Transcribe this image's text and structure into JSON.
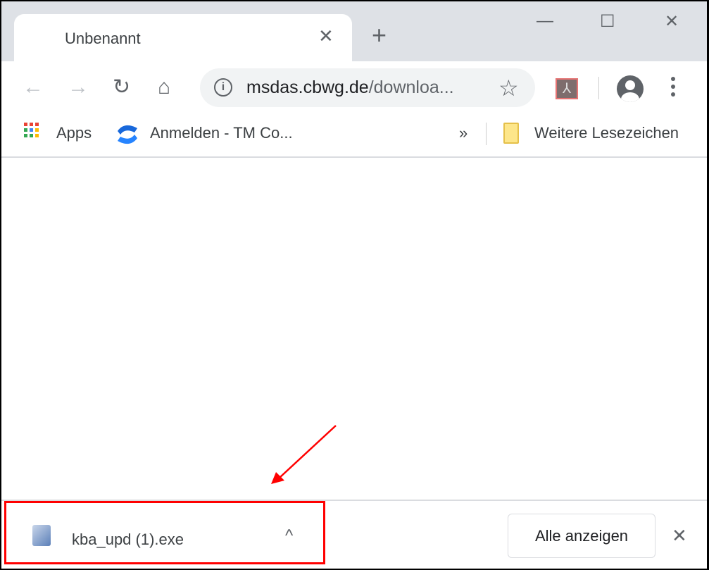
{
  "tab": {
    "title": "Unbenannt",
    "close": "✕",
    "new_tab": "+"
  },
  "window_controls": {
    "minimize": "—",
    "maximize": "☐",
    "close": "✕"
  },
  "toolbar": {
    "back": "←",
    "forward": "→",
    "reload": "↻",
    "home": "⌂",
    "url_host": "msdas.cbwg.de",
    "url_path": "/downloa...",
    "star": "☆",
    "pdf_ext_icon": "adobe-acrobat-icon"
  },
  "bookmarks": {
    "apps": "Apps",
    "item1": "Anmelden - TM Co...",
    "overflow": "»",
    "other": "Weitere Lesezeichen"
  },
  "download_shelf": {
    "filename": "kba_upd (1).exe",
    "chevron": "^",
    "show_all": "Alle anzeigen",
    "close": "✕"
  },
  "annotation": {
    "color": "#ff0000"
  },
  "colors": {
    "tabstrip": "#dee1e6",
    "omnibox": "#f1f3f4",
    "confluence": "#1868db"
  }
}
